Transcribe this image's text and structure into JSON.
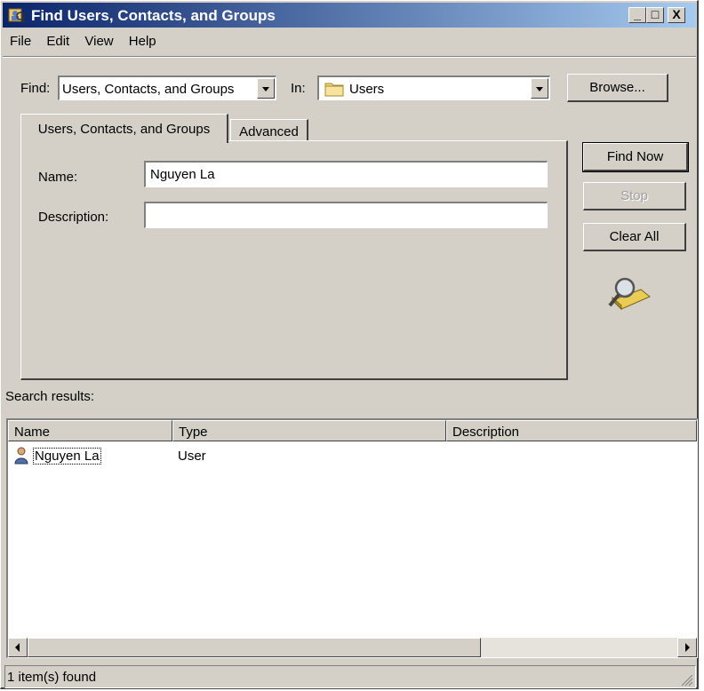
{
  "window": {
    "title": "Find Users, Contacts, and Groups"
  },
  "title_buttons": {
    "minimize": "_",
    "maximize": "□",
    "close": "X"
  },
  "menu": [
    "File",
    "Edit",
    "View",
    "Help"
  ],
  "find": {
    "label": "Find:",
    "value": "Users, Contacts, and Groups"
  },
  "in": {
    "label": "In:",
    "value": "Users"
  },
  "buttons": {
    "browse": "Browse...",
    "find_now": "Find Now",
    "stop": "Stop",
    "clear_all": "Clear All"
  },
  "tabs": [
    "Users, Contacts, and Groups",
    "Advanced"
  ],
  "fields": {
    "name": {
      "label": "Name:",
      "value": "Nguyen La"
    },
    "description": {
      "label": "Description:",
      "value": ""
    }
  },
  "results": {
    "label": "Search results:",
    "columns": [
      "Name",
      "Type",
      "Description"
    ],
    "rows": [
      {
        "name": "Nguyen La",
        "type": "User",
        "description": ""
      }
    ]
  },
  "status": "1 item(s) found"
}
